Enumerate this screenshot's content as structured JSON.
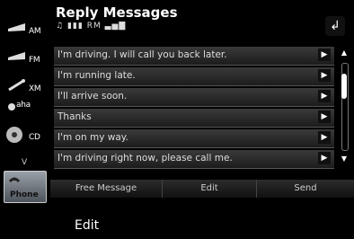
{
  "sidebar": {
    "items": [
      {
        "label": "AM",
        "icon": "radio-am-icon"
      },
      {
        "label": "FM",
        "icon": "radio-fm-icon"
      },
      {
        "label": "XM",
        "icon": "satellite-xm-icon"
      },
      {
        "label": "aha",
        "icon": "aha-icon"
      },
      {
        "label": "CD",
        "icon": "cd-icon"
      },
      {
        "label": "V",
        "icon": "chevron-down-icon"
      }
    ],
    "phone_label": "Phone"
  },
  "header": {
    "title": "Reply Messages",
    "status_text": "RM"
  },
  "messages": [
    "I'm driving. I will call you back later.",
    "I'm running late.",
    "I'll arrive soon.",
    "Thanks",
    "I'm on my way.",
    "I'm driving right now, please call me."
  ],
  "bottom": {
    "free_message": "Free Message",
    "edit": "Edit",
    "send": "Send"
  },
  "caption": "Edit"
}
